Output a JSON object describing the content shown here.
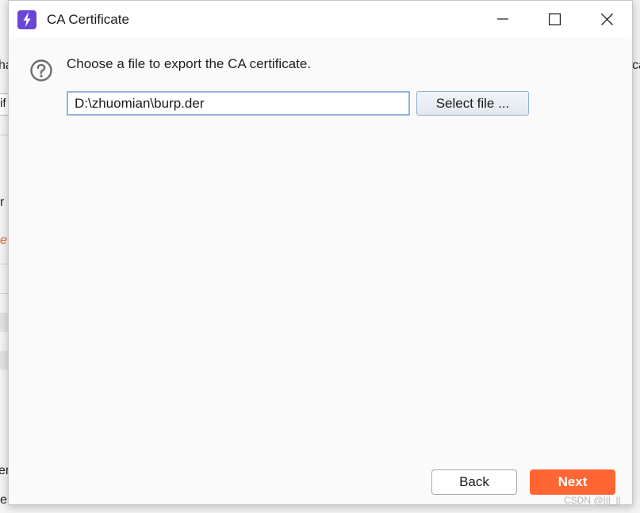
{
  "window": {
    "title": "CA Certificate",
    "controls": [
      "minimize",
      "maximize",
      "close"
    ]
  },
  "content": {
    "prompt": "Choose a file to export the CA certificate.",
    "file_path": "D:\\zhuomian\\burp.der",
    "select_file_label": "Select file ..."
  },
  "footer": {
    "back_label": "Back",
    "next_label": "Next"
  },
  "background": {
    "fragments": [
      "ha",
      "if",
      "r",
      "e",
      "er",
      "e",
      "ca"
    ]
  },
  "watermark": "CSDN @|||_||",
  "colors": {
    "accent": "#ff6633",
    "app_icon": "#6b45d6",
    "input_border": "#90b4dc"
  },
  "icons": {
    "app": "burp-lightning-icon",
    "help": "question-circle-icon"
  }
}
